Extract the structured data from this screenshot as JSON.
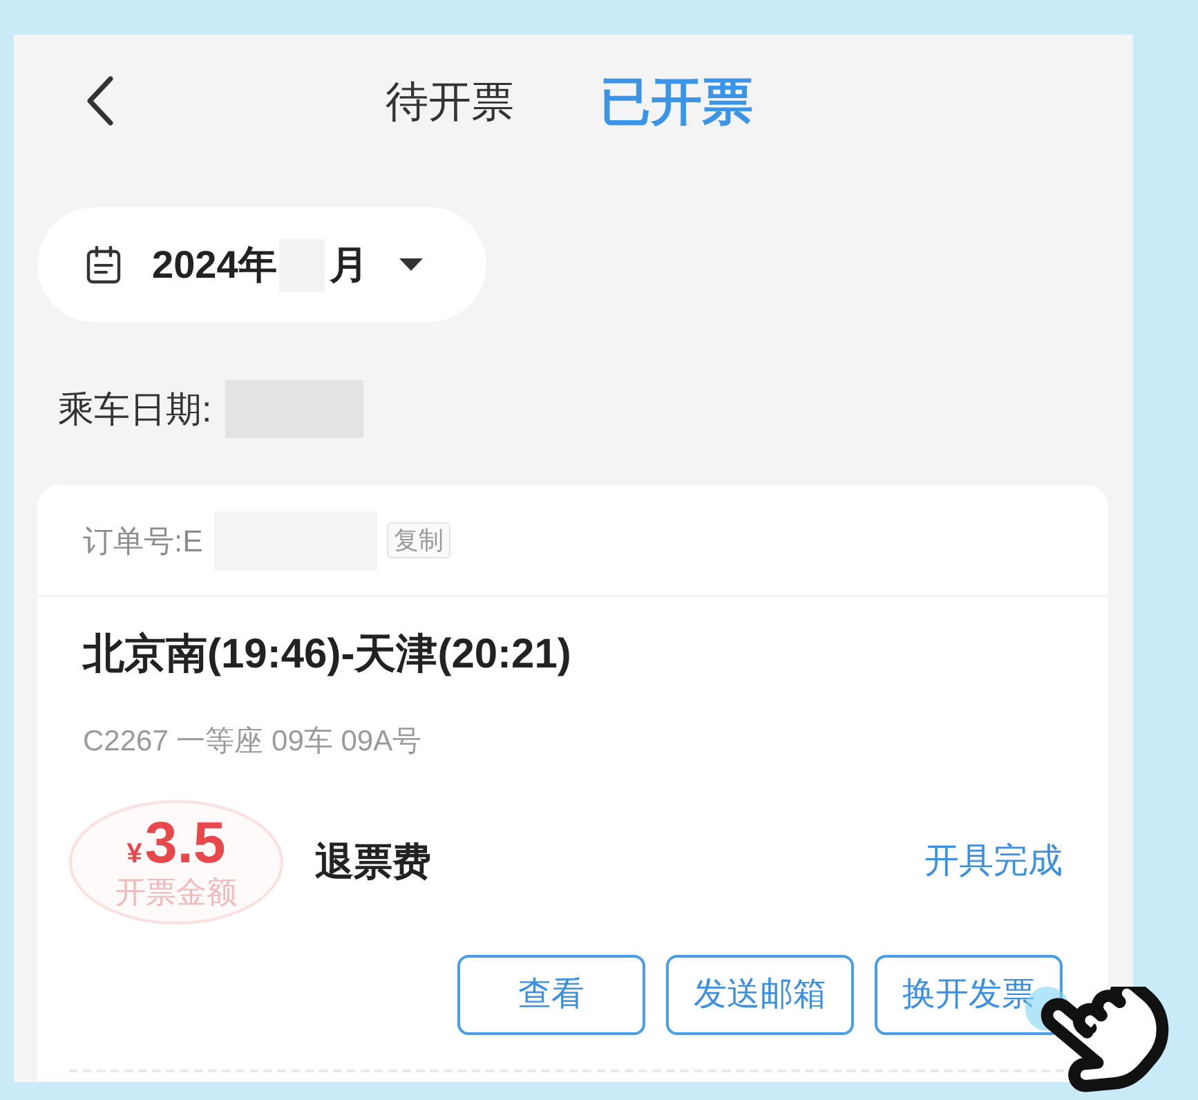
{
  "header": {
    "tabs": [
      {
        "label": "待开票",
        "selected": false
      },
      {
        "label": "已开票",
        "selected": true
      }
    ]
  },
  "month_filter": {
    "year_text": "2024年",
    "month_text": "月"
  },
  "ride_date": {
    "label": "乘车日期:"
  },
  "orders": [
    {
      "order_label": "订单号:E",
      "copy_button": "复制",
      "route": "北京南(19:46)-天津(20:21)",
      "train_info": "C2267 一等座 09车 09A号",
      "currency_symbol": "¥",
      "amount": "3.5",
      "amount_label": "开票金额",
      "fee_type": "退票费",
      "status": "开具完成",
      "actions": [
        "查看",
        "发送邮箱",
        "换开发票"
      ]
    }
  ]
}
